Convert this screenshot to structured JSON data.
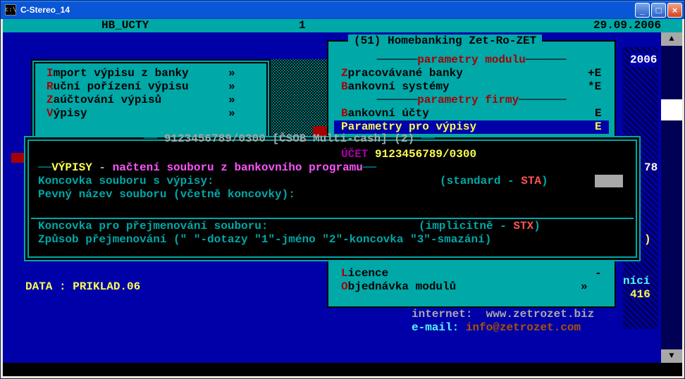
{
  "window": {
    "title": "C-Stereo_14",
    "icon": "c:\\"
  },
  "titlebar_buttons": {
    "min": "_",
    "max": "□",
    "close": "×"
  },
  "status": {
    "left": "HB_UCTY",
    "mid": "1",
    "right": "29.09.2006"
  },
  "year_overlay": "2006",
  "menu_left": {
    "items": [
      {
        "hot": "I",
        "text": "mport výpisu z banky",
        "mark": "»"
      },
      {
        "hot": "R",
        "text": "uční pořízení výpisu",
        "mark": "»"
      },
      {
        "hot": "Z",
        "text": "aúčtování výpisů",
        "mark": "»"
      },
      {
        "hot": "V",
        "text": "ýpisy",
        "mark": "»"
      }
    ]
  },
  "menu_right": {
    "title": "(51) Homebanking Zet-Ro-ZET",
    "sect1": "parametry modulu",
    "items1": [
      {
        "hot": "Z",
        "text": "pracovávané banky",
        "mark": "+E"
      },
      {
        "hot": "B",
        "text": "ankovní systémy",
        "mark": "*E"
      }
    ],
    "sect2": "parametry firmy",
    "items2": [
      {
        "hot": "B",
        "text": "ankovní účty",
        "mark": "E"
      },
      {
        "hot": "P",
        "text": "arametry pro výpisy",
        "mark": "E",
        "selected": true
      }
    ],
    "items3": [
      {
        "hot": "L",
        "text": "icence",
        "mark": "-"
      },
      {
        "hot": "O",
        "text": "bjednávka modulů",
        "mark": "»"
      }
    ]
  },
  "dialog": {
    "header": "9123456789/0300 [ČSOB Multi-cash] (2)",
    "ucet_label": "ÚČET",
    "ucet_value": "9123456789/0300",
    "section": "VÝPISY",
    "section_desc_1": " - ",
    "section_desc_2": "načtení souboru z bankovního programu",
    "line1": "Koncovka souboru s výpisy:",
    "line1_hint": "(standard - ",
    "line1_val": "STA",
    "line1_close": ")",
    "line2": "Pevný název souboru (včetně koncovky):",
    "line3": "Koncovka pro přejmenování souboru:",
    "line3_hint": "(implicitně - ",
    "line3_val": "STX",
    "line3_close": ")",
    "line4": "Způsob přejmenování (\" \"-dotazy \"1\"-jméno \"2\"-koncovka \"3\"-smazání)"
  },
  "data_path": {
    "label": "DATA : ",
    "value": "PRIKLAD.06"
  },
  "footer": {
    "frag_nici": "nící",
    "num": "416",
    "num2": "78",
    "internet_label": "internet:",
    "internet_val": "www.zetrozet.biz",
    "email_label": "e-mail:",
    "email_val": "info@zetrozet.com"
  }
}
